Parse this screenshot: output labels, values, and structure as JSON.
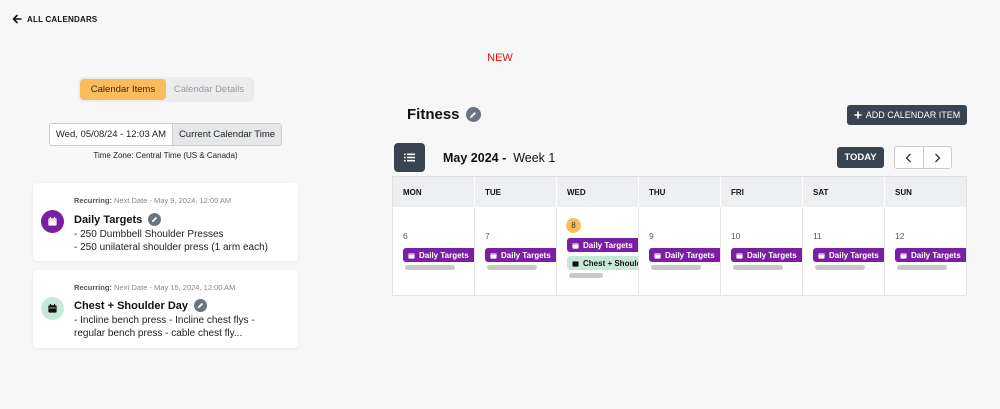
{
  "nav": {
    "back_label": "ALL CALENDARS"
  },
  "badge": {
    "new_label": "NEW"
  },
  "tabs": [
    {
      "label": "Calendar Items",
      "active": true
    },
    {
      "label": "Calendar Details",
      "active": false
    }
  ],
  "time_box": {
    "datetime": "Wed, 05/08/24 - 12:03 AM",
    "current_label": "Current Calendar Time",
    "timezone": "Time Zone: Central Time (US & Canada)"
  },
  "items": [
    {
      "recurring_label": "Recurring:",
      "next_date": "Next Date - May 9, 2024, 12:00 AM",
      "title": "Daily Targets",
      "desc_line1": "- 250 Dumbbell Shoulder Presses",
      "desc_line2": "- 250 unilateral shoulder press (1 arm each)",
      "icon": "calendar-icon",
      "color": "#7b1fa2"
    },
    {
      "recurring_label": "Recurring:",
      "next_date": "Next Date - May 15, 2024, 12:00 AM",
      "title": "Chest + Shoulder Day",
      "desc_line1": "- Incline bench press - Incline chest flys -",
      "desc_line2": "regular bench press - cable chest fly...",
      "icon": "calendar-icon",
      "color": "#c7e8d8"
    }
  ],
  "calendar": {
    "name": "Fitness",
    "add_label": "ADD CALENDAR ITEM",
    "month_label": "May 2024 -",
    "week_label": "Week 1",
    "today_label": "TODAY",
    "weekdays": [
      "MON",
      "TUE",
      "WED",
      "THU",
      "FRI",
      "SAT",
      "SUN"
    ],
    "days": [
      {
        "num": "6",
        "events": [
          "Daily Targets"
        ]
      },
      {
        "num": "7",
        "events": [
          "Daily Targets"
        ]
      },
      {
        "num": "8",
        "events": [
          "Daily Targets",
          "Chest + Shoulder Day"
        ],
        "today": true
      },
      {
        "num": "9",
        "events": [
          "Daily Targets"
        ]
      },
      {
        "num": "10",
        "events": [
          "Daily Targets"
        ]
      },
      {
        "num": "11",
        "events": [
          "Daily Targets"
        ]
      },
      {
        "num": "12",
        "events": [
          "Daily Targets"
        ]
      }
    ],
    "event_colors": {
      "Daily Targets": "#7b1fa2",
      "Chest + Shoulder Day": "#c7e8d8"
    },
    "accent": "#fbbd5c",
    "dark": "#3a4350"
  }
}
